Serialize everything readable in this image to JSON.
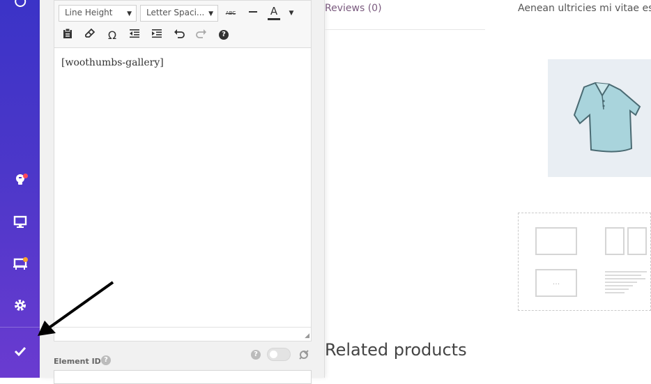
{
  "toolbar": {
    "line_height_label": "Line Height",
    "letter_spacing_label": "Letter Spaci...",
    "strikethrough_label": "ABC",
    "text_color_label": "A"
  },
  "editor": {
    "content": "[woothumbs-gallery]"
  },
  "fields": {
    "element_id_label": "Element ID",
    "help_symbol": "?"
  },
  "page": {
    "reviews_tab": "Reviews (0)",
    "description_text": "Aenean ultricies mi vitae est.",
    "related_heading": "Related products",
    "layout_dots": "..."
  },
  "colors": {
    "rail_top": "#3b33c7",
    "rail_bottom": "#6a3bd0",
    "notification_red": "#ff4a5a",
    "notification_orange": "#ffa62b",
    "link_purple": "#7a5a7e"
  },
  "icons": {
    "rail": [
      "history-icon",
      "lightbulb-icon",
      "desktop-icon",
      "layout-icon",
      "gear-icon",
      "checkmark-icon"
    ],
    "toolbar": [
      "paste-icon",
      "eraser-icon",
      "omega-icon",
      "outdent-icon",
      "indent-icon",
      "undo-icon",
      "redo-icon",
      "help-icon"
    ]
  }
}
